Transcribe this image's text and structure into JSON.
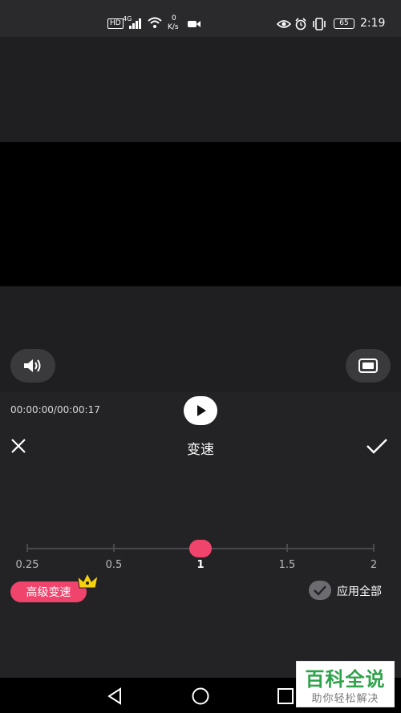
{
  "status_bar": {
    "hd": "HD",
    "network": "4G",
    "speed_value": "0",
    "speed_unit": "K/s",
    "battery": "65",
    "time": "2:19"
  },
  "player": {
    "time_display": "00:00:00/00:00:17"
  },
  "panel": {
    "title": "变速"
  },
  "speed_slider": {
    "ticks": [
      "0.25",
      "0.5",
      "1",
      "1.5",
      "2"
    ],
    "selected": "1"
  },
  "advanced": {
    "label": "高级变速"
  },
  "apply_all": {
    "label": "应用全部"
  },
  "watermark": {
    "title": "百科全说",
    "subtitle": "助你轻松解决"
  },
  "colors": {
    "accent": "#f0446d",
    "crown": "#f5d20a"
  }
}
